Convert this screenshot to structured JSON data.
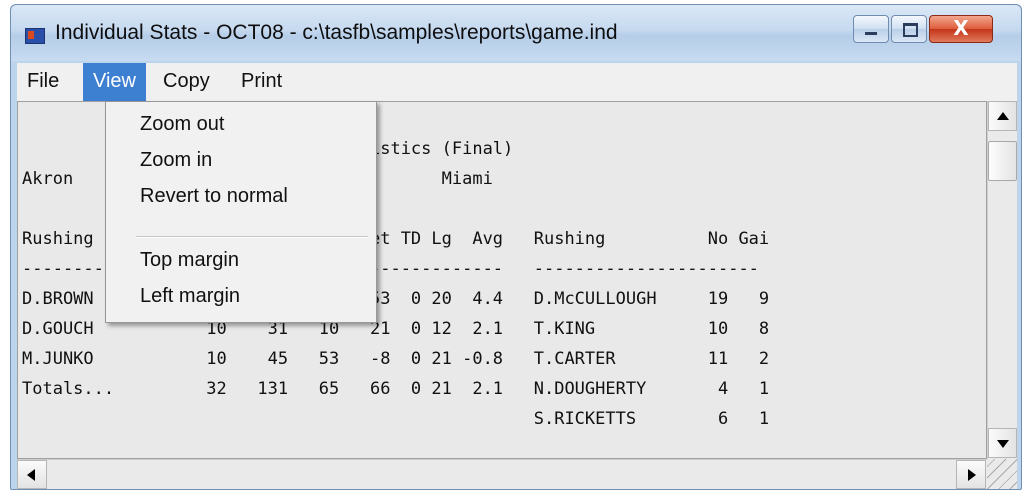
{
  "window": {
    "title": "Individual Stats - OCT08 - c:\\tasfb\\samples\\reports\\game.ind",
    "close_glyph": "X"
  },
  "menubar": {
    "items": [
      {
        "label": "File"
      },
      {
        "label": "View"
      },
      {
        "label": "Copy"
      },
      {
        "label": "Print"
      }
    ],
    "active": "View"
  },
  "view_menu": {
    "items": [
      "Zoom out",
      "Zoom in",
      "Revert to normal",
      "Top margin",
      "Left margin"
    ]
  },
  "report": {
    "lines": [
      "",
      "                   Individual Statistics (Final)",
      "Akron                                    Miami",
      "",
      "Rushing           No  Gain Loss  Net TD Lg  Avg   Rushing          No Gai",
      "-----------------------------------------------   ----------------------",
      "D.BROWN           12    55    2   53  0 20  4.4   D.McCULLOUGH     19   9",
      "D.GOUCH           10    31   10   21  0 12  2.1   T.KING           10   8",
      "M.JUNKO           10    45   53   -8  0 21 -0.8   T.CARTER         11   2",
      "Totals...         32   131   65   66  0 21  2.1   N.DOUGHERTY       4   1",
      "                                                  S.RICKETTS        6   1"
    ]
  },
  "icons": {
    "app": "app-icon",
    "minimize": "minimize-icon",
    "maximize": "maximize-icon",
    "close": "close-icon"
  },
  "colors": {
    "menu_highlight": "#3d7fd0",
    "close_button": "#c43519"
  }
}
